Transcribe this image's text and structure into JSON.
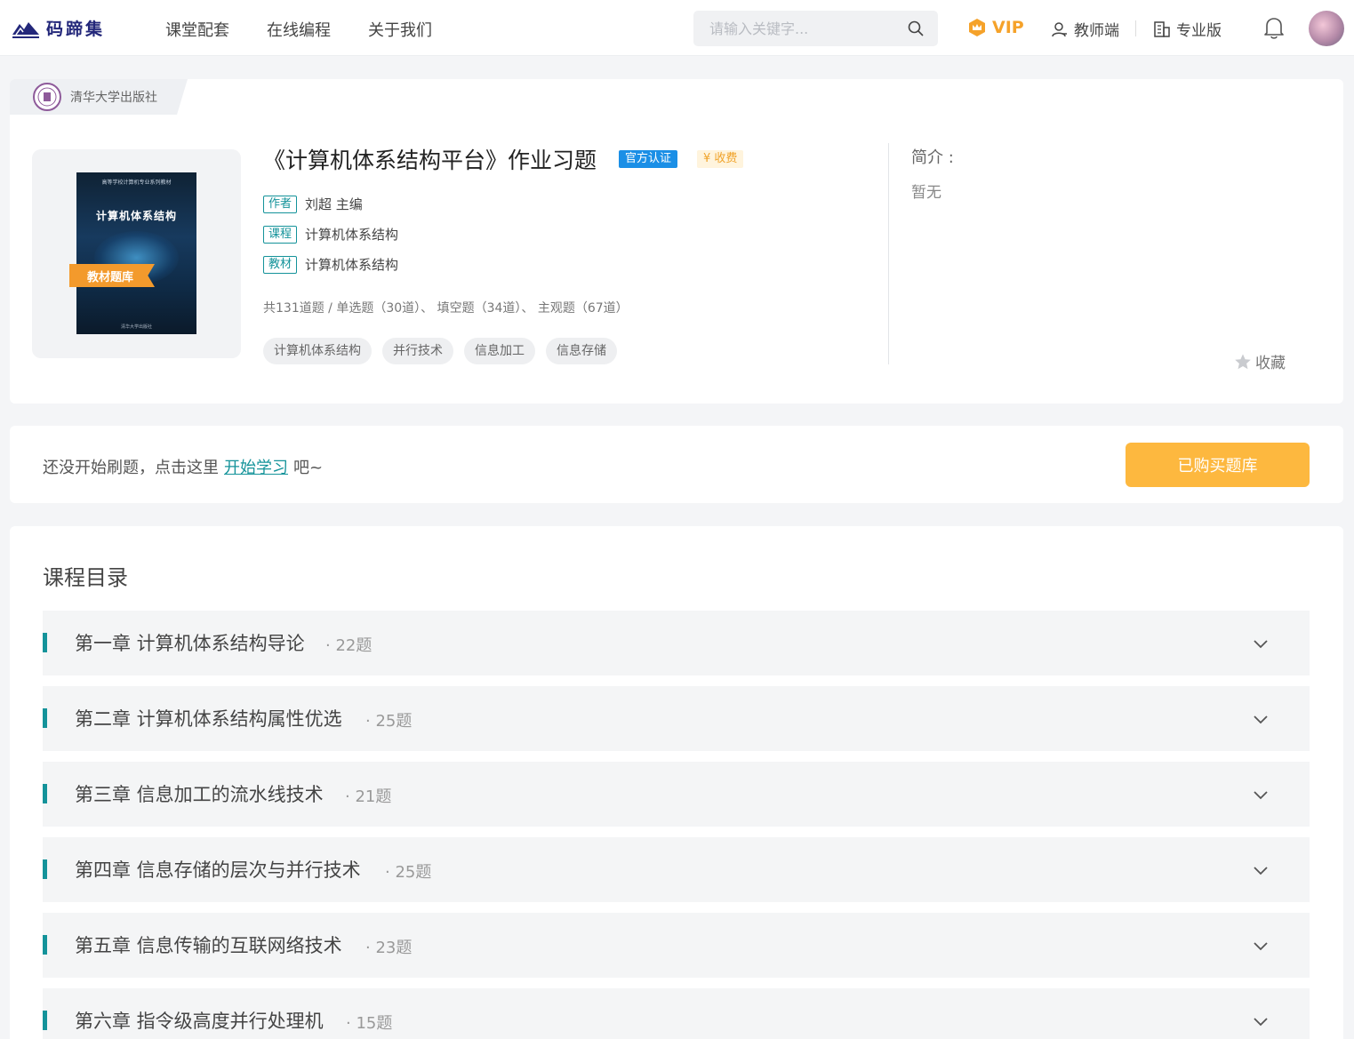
{
  "header": {
    "logo_text": "码蹄集",
    "nav": [
      "课堂配套",
      "在线编程",
      "关于我们"
    ],
    "search_placeholder": "请输入关键字...",
    "vip_label": "VIP",
    "teacher_label": "教师端",
    "pro_label": "专业版"
  },
  "book": {
    "publisher": "清华大学出版社",
    "cover_sub": "高等学校计算机专业系列教材",
    "cover_title": "计算机体系结构",
    "cover_ribbon": "教材题库",
    "cover_foot": "清华大学出版社",
    "title": "《计算机体系结构平台》作业习题",
    "badge_official": "官方认证",
    "badge_fee": "¥ 收费",
    "meta": [
      {
        "tag": "作者",
        "value": "刘超 主编"
      },
      {
        "tag": "课程",
        "value": "计算机体系结构"
      },
      {
        "tag": "教材",
        "value": "计算机体系结构"
      }
    ],
    "stats": "共131道题 / 单选题（30道）、 填空题（34道）、 主观题（67道）",
    "tags": [
      "计算机体系结构",
      "并行技术",
      "信息加工",
      "信息存储"
    ],
    "intro_label": "简介 :",
    "intro_text": "暂无",
    "favorite_label": "收藏"
  },
  "start": {
    "prefix": "还没开始刷题，点击这里",
    "link": "开始学习",
    "suffix": "吧~",
    "button": "已购买题库"
  },
  "catalog": {
    "title": "课程目录",
    "chapters": [
      {
        "title": "第一章 计算机体系结构导论",
        "count": "· 22题"
      },
      {
        "title": "第二章 计算机体系结构属性优选",
        "count": "· 25题"
      },
      {
        "title": "第三章 信息加工的流水线技术",
        "count": "· 21题"
      },
      {
        "title": "第四章 信息存储的层次与并行技术",
        "count": "· 25题"
      },
      {
        "title": "第五章 信息传输的互联网络技术",
        "count": "· 23题"
      },
      {
        "title": "第六章 指令级高度并行处理机",
        "count": "· 15题"
      }
    ]
  },
  "colors": {
    "accent": "#14939a",
    "button": "#fdb83f",
    "vip": "#f5a22a",
    "official": "#1b8fe6"
  }
}
